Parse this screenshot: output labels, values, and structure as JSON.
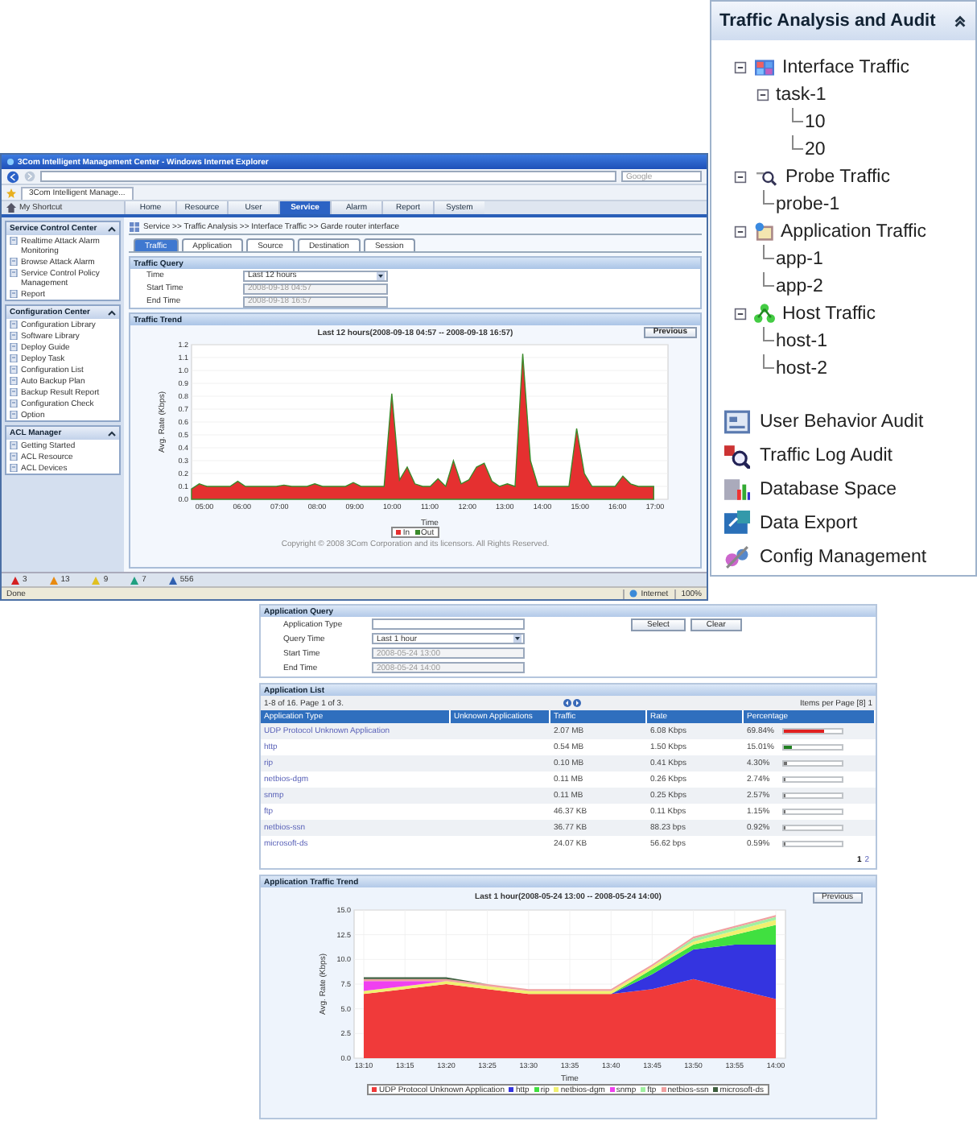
{
  "browser": {
    "title": "3Com Intelligent Management Center - Windows Internet Explorer",
    "tab_title": "3Com Intelligent Manage...",
    "search": {
      "placeholder": "Google"
    },
    "shortcut": "My Shortcut",
    "nav": [
      {
        "label": "Home",
        "selected": false
      },
      {
        "label": "Resource",
        "selected": false
      },
      {
        "label": "User",
        "selected": false
      },
      {
        "label": "Service",
        "selected": true
      },
      {
        "label": "Alarm",
        "selected": false
      },
      {
        "label": "Report",
        "selected": false
      },
      {
        "label": "System",
        "selected": false
      }
    ],
    "sidebar": [
      {
        "title": "Service Control Center",
        "items": [
          "Realtime Attack Alarm Monitoring",
          "Browse Attack Alarm",
          "Service Control Policy Management",
          "Report"
        ]
      },
      {
        "title": "Configuration Center",
        "items": [
          "Configuration Library",
          "Software Library",
          "Deploy Guide",
          "Deploy Task",
          "Configuration List",
          "Auto Backup Plan",
          "Backup Result Report",
          "Configuration Check",
          "Option"
        ]
      },
      {
        "title": "ACL Manager",
        "items": [
          "Getting Started",
          "ACL Resource",
          "ACL Devices"
        ]
      }
    ],
    "breadcrumb": "Service >> Traffic Analysis >> Interface Traffic >> Garde router interface",
    "tabs": [
      {
        "label": "Traffic",
        "selected": true
      },
      {
        "label": "Application",
        "selected": false
      },
      {
        "label": "Source",
        "selected": false
      },
      {
        "label": "Destination",
        "selected": false
      },
      {
        "label": "Session",
        "selected": false
      }
    ],
    "traffic_query": {
      "title": "Traffic Query",
      "fields": [
        {
          "label": "Time",
          "kind": "select",
          "value": "Last 12 hours",
          "disabled": false
        },
        {
          "label": "Start Time",
          "kind": "text",
          "value": "2008-09-18 04:57",
          "disabled": true
        },
        {
          "label": "End Time",
          "kind": "text",
          "value": "2008-09-18 16:57",
          "disabled": true
        }
      ]
    },
    "traffic_trend": {
      "title": "Traffic Trend",
      "chart_title": "Last 12 hours(2008-09-18 04:57 -- 2008-09-18 16:57)",
      "button": "Previous",
      "ylabel": "Avg. Rate (Kbps)",
      "xlabel": "Time",
      "yticks": [
        "1.2",
        "1.1",
        "1.0",
        "0.9",
        "0.8",
        "0.7",
        "0.6",
        "0.5",
        "0.4",
        "0.3",
        "0.2",
        "0.1",
        "0.0"
      ],
      "xticks": [
        "05:00",
        "06:00",
        "07:00",
        "08:00",
        "09:00",
        "10:00",
        "11:00",
        "12:00",
        "13:00",
        "14:00",
        "15:00",
        "16:00",
        "17:00"
      ],
      "legend": [
        {
          "label": "In",
          "color": "#e53030"
        },
        {
          "label": "Out",
          "color": "#3a8a2a"
        }
      ]
    },
    "copyright": "Copyright © 2008 3Com Corporation and its licensors. All Rights Reserved.",
    "alarms": [
      {
        "count": "3",
        "color": "#d42020"
      },
      {
        "count": "13",
        "color": "#e88a10"
      },
      {
        "count": "9",
        "color": "#e0c020"
      },
      {
        "count": "7",
        "color": "#20a080"
      },
      {
        "count": "556",
        "color": "#3060b0"
      }
    ],
    "status": "Done",
    "zone": "Internet",
    "zoom": "100%"
  },
  "audit_panel": {
    "title": "Traffic Analysis and Audit",
    "tree": [
      {
        "label": "Interface Traffic",
        "kind": "interface",
        "expanded": true,
        "children": [
          {
            "label": "task-1",
            "expanded": true,
            "children": [
              {
                "label": "10"
              },
              {
                "label": "20"
              }
            ]
          }
        ]
      },
      {
        "label": "Probe Traffic",
        "kind": "probe",
        "expanded": true,
        "children": [
          {
            "label": "probe-1"
          }
        ]
      },
      {
        "label": "Application Traffic",
        "kind": "application",
        "expanded": true,
        "children": [
          {
            "label": "app-1"
          },
          {
            "label": "app-2"
          }
        ]
      },
      {
        "label": "Host Traffic",
        "kind": "host",
        "expanded": true,
        "children": [
          {
            "label": "host-1"
          },
          {
            "label": "host-2"
          }
        ]
      }
    ],
    "items": [
      {
        "label": "User Behavior Audit",
        "kind": "user"
      },
      {
        "label": "Traffic Log Audit",
        "kind": "log"
      },
      {
        "label": "Database Space",
        "kind": "database"
      },
      {
        "label": "Data Export",
        "kind": "export"
      },
      {
        "label": "Config Management",
        "kind": "config"
      }
    ]
  },
  "app_panel": {
    "query": {
      "title": "Application Query",
      "fields": [
        {
          "label": "Application Type",
          "kind": "text",
          "disabled": false
        },
        {
          "label": "Query Time",
          "kind": "select",
          "value": "Last 1 hour",
          "disabled": false
        },
        {
          "label": "Start Time",
          "kind": "text",
          "value": "2008-05-24 13:00",
          "disabled": true
        },
        {
          "label": "End Time",
          "kind": "text",
          "value": "2008-05-24 14:00",
          "disabled": true
        }
      ],
      "buttons": [
        "Select",
        "Clear"
      ]
    },
    "list": {
      "title": "Application List",
      "summary": "1-8 of 16. Page 1 of 3.",
      "per_page": "Items per Page [8] 1",
      "columns": [
        "Application Type",
        "Unknown Applications",
        "Traffic",
        "Rate",
        "Percentage"
      ],
      "rows": [
        {
          "name": "UDP Protocol Unknown Application",
          "traffic": "2.07 MB",
          "rate": "6.08 Kbps",
          "percentage": "69.84%",
          "level": 0.6984,
          "color": "#e02020"
        },
        {
          "name": "http",
          "traffic": "0.54 MB",
          "rate": "1.50 Kbps",
          "percentage": "15.01%",
          "level": 0.1501,
          "color": "#208020"
        },
        {
          "name": "rip",
          "traffic": "0.10 MB",
          "rate": "0.41 Kbps",
          "percentage": "4.30%",
          "level": 0.043,
          "color": "#707070"
        },
        {
          "name": "netbios-dgm",
          "traffic": "0.11 MB",
          "rate": "0.26 Kbps",
          "percentage": "2.74%",
          "level": 0.0274,
          "color": "#707070"
        },
        {
          "name": "snmp",
          "traffic": "0.11 MB",
          "rate": "0.25 Kbps",
          "percentage": "2.57%",
          "level": 0.0257,
          "color": "#707070"
        },
        {
          "name": "ftp",
          "traffic": "46.37 KB",
          "rate": "0.11 Kbps",
          "percentage": "1.15%",
          "level": 0.0115,
          "color": "#707070"
        },
        {
          "name": "netbios-ssn",
          "traffic": "36.77 KB",
          "rate": "88.23 bps",
          "percentage": "0.92%",
          "level": 0.0092,
          "color": "#707070"
        },
        {
          "name": "microsoft-ds",
          "traffic": "24.07 KB",
          "rate": "56.62 bps",
          "percentage": "0.59%",
          "level": 0.0059,
          "color": "#707070"
        }
      ],
      "pages": [
        {
          "label": "1",
          "selected": true
        },
        {
          "label": "2",
          "selected": false
        }
      ]
    },
    "trend": {
      "title": "Application Traffic Trend",
      "button": "Previous",
      "chart_title": "Last 1 hour(2008-05-24 13:00 -- 2008-05-24 14:00)",
      "xlabel": "Time",
      "ylabel": "Avg. Rate (Kbps)",
      "xticks": [
        "13:10",
        "13:15",
        "13:20",
        "13:25",
        "13:30",
        "13:35",
        "13:40",
        "13:45",
        "13:50",
        "13:55",
        "14:00"
      ],
      "yticks": [
        "15.0",
        "12.5",
        "10.0",
        "7.5",
        "5.0",
        "2.5",
        "0.0"
      ],
      "legend": [
        {
          "label": "UDP Protocol Unknown Application",
          "color": "#f03a3a"
        },
        {
          "label": "http",
          "color": "#3434e0"
        },
        {
          "label": "rip",
          "color": "#40e040"
        },
        {
          "label": "netbios-dgm",
          "color": "#f0f070"
        },
        {
          "label": "snmp",
          "color": "#f040f0"
        },
        {
          "label": "ftp",
          "color": "#a0f0a0"
        },
        {
          "label": "netbios-ssn",
          "color": "#f0a0a0"
        },
        {
          "label": "microsoft-ds",
          "color": "#406040"
        }
      ]
    }
  }
}
